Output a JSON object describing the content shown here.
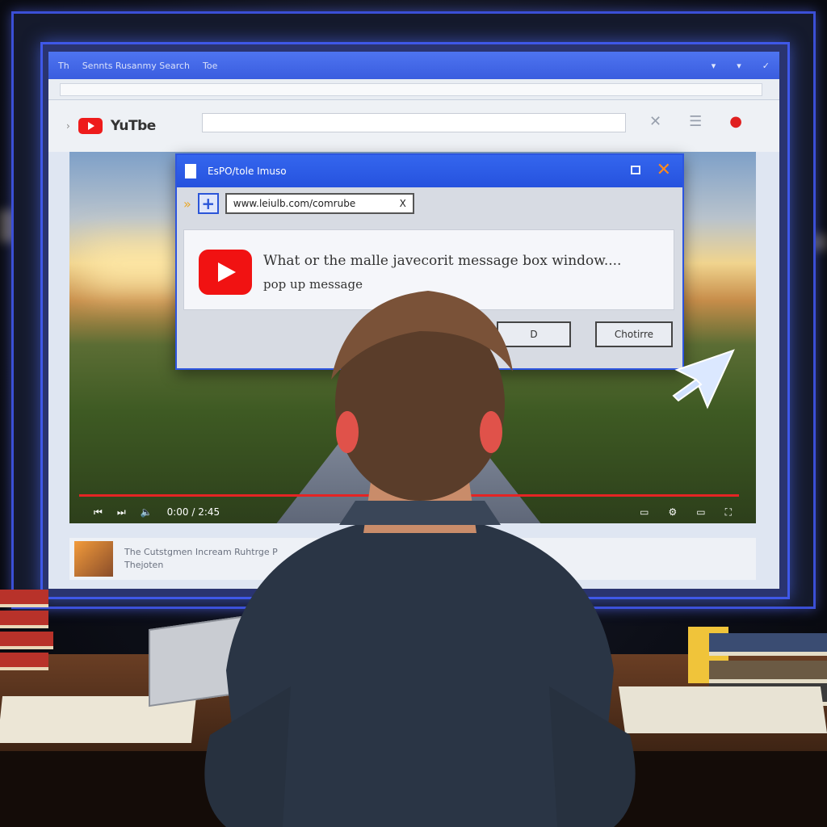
{
  "browser": {
    "tabs": [
      "Th",
      "Sennts Rusanmy Search",
      "Toe"
    ],
    "window_controls": [
      "▾",
      "▾",
      "✓"
    ]
  },
  "site": {
    "brand": "YuTbe",
    "header_icons": {
      "close": "✕",
      "menu": "☰",
      "alert": "●"
    }
  },
  "player": {
    "time": "0:00 / 2:45",
    "progress": 0.99
  },
  "below_video": {
    "title": "The Cutstgmen Incream Ruhtrge P",
    "channel": "Thejoten"
  },
  "dialog": {
    "title": "EsPO/tole Imuso",
    "url": "www.leiulb.com/comrube",
    "url_close": "X",
    "message": "What or the malle javecorit message box window....",
    "sub_message": "pop up  message",
    "ok_label": "D",
    "change_label": "Chotirre"
  },
  "icons": {
    "app": "app-icon",
    "back": "chevron-right-icon",
    "plus": "plus-icon",
    "close": "close-icon",
    "cursor": "mouse-pointer-icon"
  },
  "colors": {
    "accent": "#2d55e0",
    "youtube_red": "#f11212",
    "close_orange": "#ff8a1d"
  }
}
